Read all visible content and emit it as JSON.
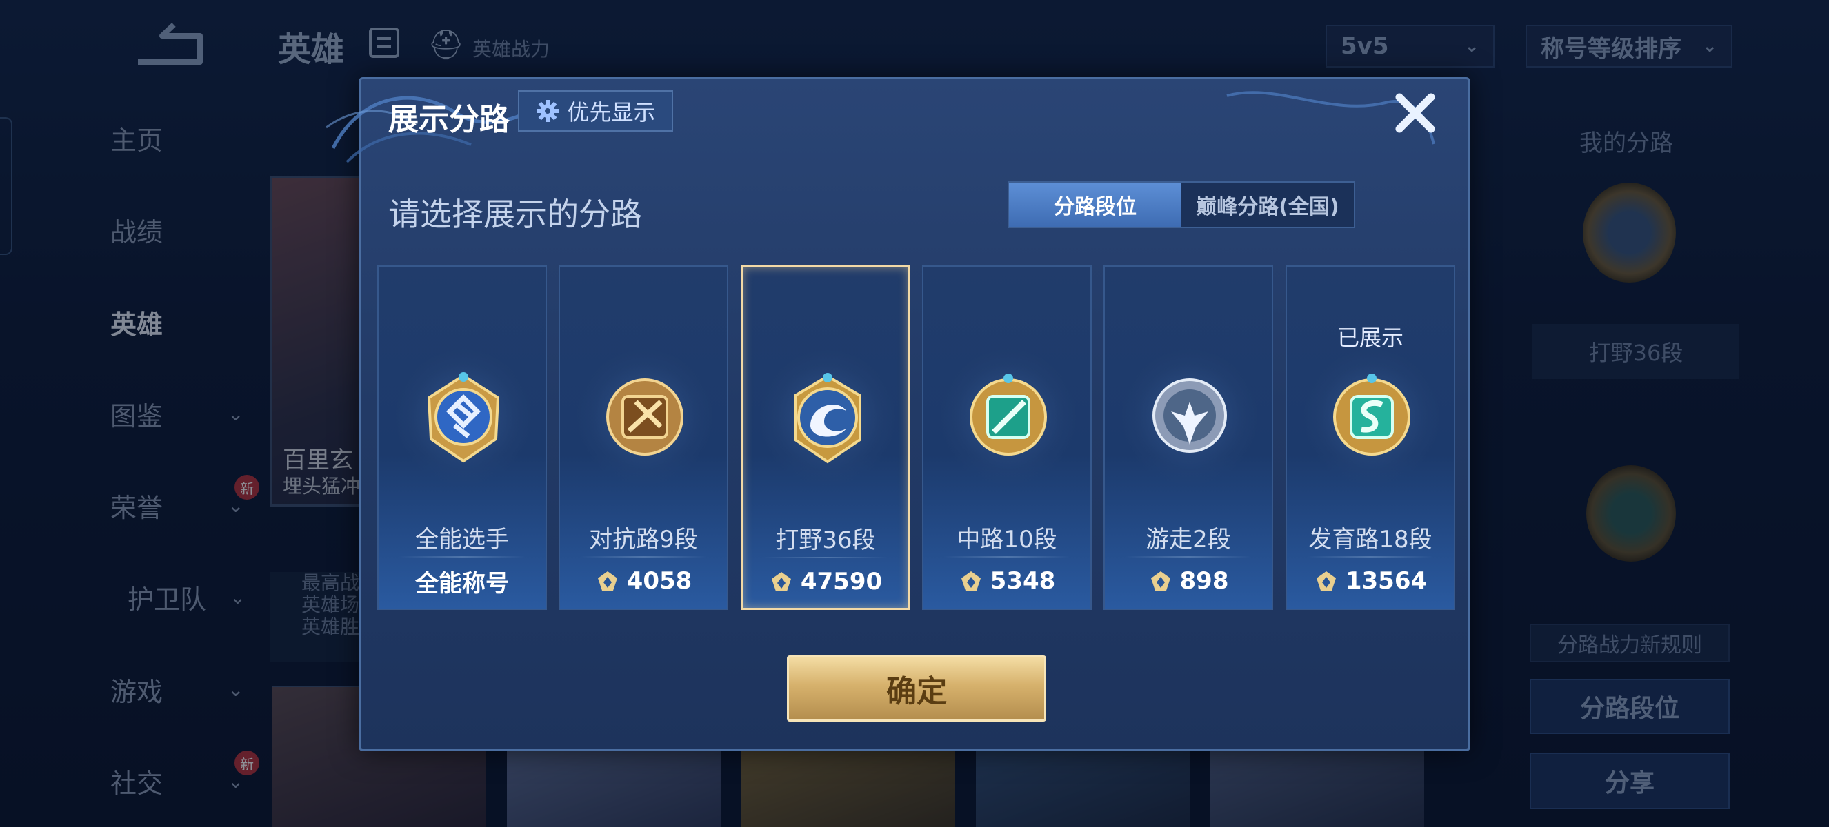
{
  "background": {
    "topbar": {
      "title": "英雄",
      "power_label": "英雄战力"
    },
    "mode_select": "5v5",
    "sort_select": "称号等级排序",
    "sidebar": [
      {
        "label": "主页"
      },
      {
        "label": "战绩"
      },
      {
        "label": "英雄"
      },
      {
        "label": "图鉴"
      },
      {
        "label": "荣誉",
        "badge": "新"
      },
      {
        "label": "护卫队"
      },
      {
        "label": "游戏"
      },
      {
        "label": "社交",
        "badge": "新"
      }
    ],
    "hero_card": {
      "name": "百里玄",
      "desc": "埋头猛冲",
      "stats": [
        "最高战",
        "英雄场",
        "英雄胜"
      ]
    },
    "right_panel": {
      "title": "我的分路",
      "current": "打野36段",
      "rule_button": "分路战力新规则",
      "segment_button": "分路段位",
      "share_button": "分享"
    }
  },
  "modal": {
    "title": "展示分路",
    "priority_button": "优先显示",
    "subtitle": "请选择展示的分路",
    "tabs": [
      {
        "label": "分路段位",
        "active": true
      },
      {
        "label": "巅峰分路(全国)",
        "active": false
      }
    ],
    "lanes": [
      {
        "name": "全能选手",
        "score": "全能称号",
        "icon": "allround-emblem-icon",
        "shown": ""
      },
      {
        "name": "对抗路9段",
        "score": "4058",
        "icon": "clash-lane-emblem-icon",
        "shown": ""
      },
      {
        "name": "打野36段",
        "score": "47590",
        "icon": "jungle-emblem-icon",
        "selected": true,
        "shown": ""
      },
      {
        "name": "中路10段",
        "score": "5348",
        "icon": "mid-lane-emblem-icon",
        "shown": ""
      },
      {
        "name": "游走2段",
        "score": "898",
        "icon": "roam-emblem-icon",
        "shown": ""
      },
      {
        "name": "发育路18段",
        "score": "13564",
        "icon": "farm-lane-emblem-icon",
        "shown": "已展示"
      }
    ],
    "confirm_button": "确定"
  },
  "colors": {
    "gold": "#d6b16c",
    "accent_blue": "#3e6cb3",
    "selected_border": "#f2d9a6"
  }
}
